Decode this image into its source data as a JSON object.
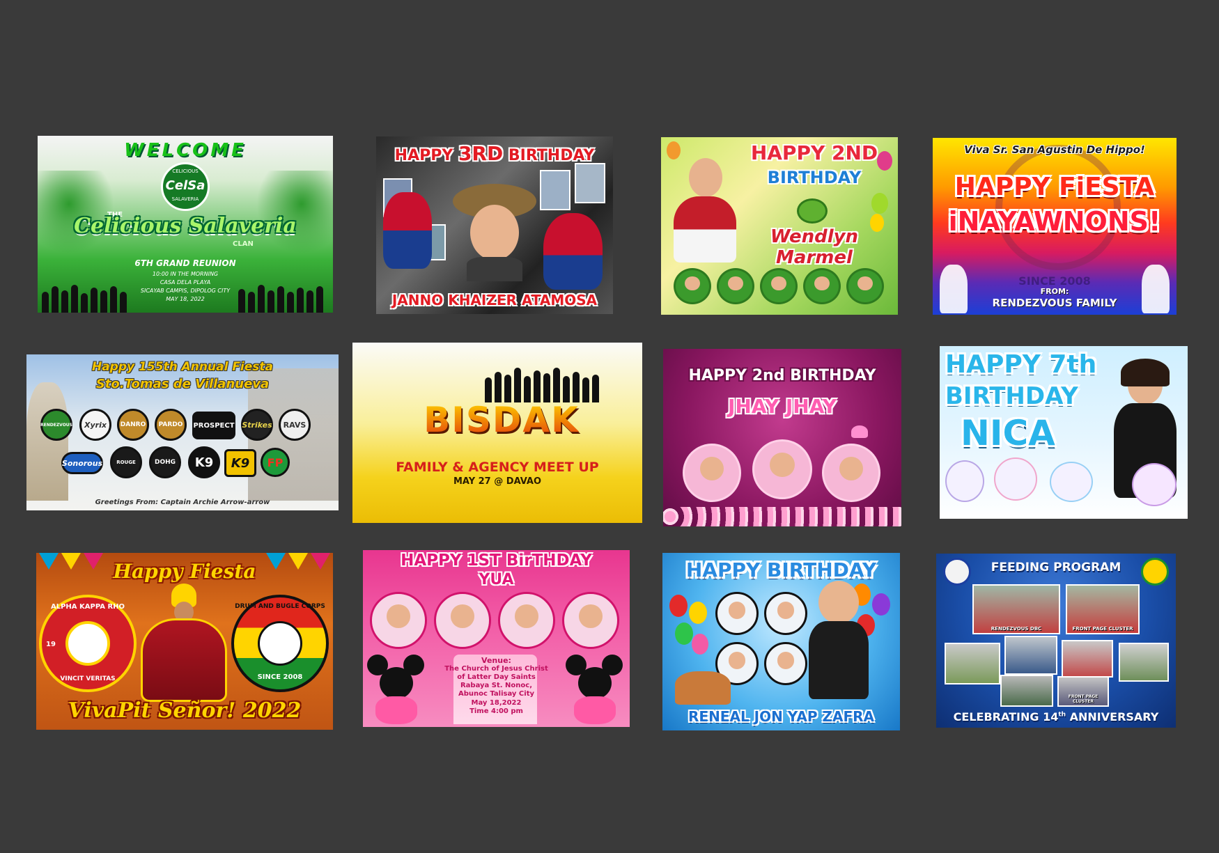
{
  "banners": [
    {
      "title": "WELCOME",
      "logo_top": "CELICIOUS",
      "logo_main": "CelSa",
      "logo_bottom": "SALAVERIA",
      "the": "THE",
      "clan_name": "Celicious Salaveria",
      "clan": "CLAN",
      "event": "6TH GRAND REUNION",
      "time": "10:00 IN THE MORNING",
      "venue": "CASA DELA PLAYA",
      "address": "SICAYAB CAMPIS, DIPOLOG CITY",
      "date": "MAY 18, 2022"
    },
    {
      "title_a": "HAPPY ",
      "title_num": "3RD",
      "title_b": " BIRTHDAY",
      "name": "JANNO KHAIZER ATAMOSA"
    },
    {
      "line1": "HAPPY 2ND",
      "line2": "BIRTHDAY",
      "name": "Wendlyn Marmel"
    },
    {
      "top": "Viva Sr. San Agustin De Hippo!",
      "line1": "HAPPY FiESTA",
      "line2": "iNAYAWNONS!",
      "from": "FROM:",
      "family": "RENDEZVOUS FAMILY",
      "since": "SINCE 2008"
    },
    {
      "line1": "Happy 155th Annual Fiesta",
      "line2": "Sto.Tomas de Villanueva",
      "logos": [
        "RENDEZVOUS",
        "Xyrix",
        "DANRO",
        "PARDO",
        "PROSPECT",
        "Strikes",
        "RAVS",
        "Sonorous",
        "ROUGE",
        "DOHG",
        "K9",
        "K9",
        "FP"
      ],
      "footer": "Greetings From: Captain Archie Arrow-arrow"
    },
    {
      "title": "BISDAK",
      "subtitle": "FAMILY & AGENCY MEET UP",
      "date": "MAY 27 @ DAVAO"
    },
    {
      "line1": "HAPPY 2nd BIRTHDAY",
      "name": "JHAY JHAY"
    },
    {
      "line1": "HAPPY 7th",
      "line2": "BIRTHDAY",
      "name": "NICA"
    },
    {
      "title": "Happy Fiesta",
      "left_logo_ring": "ALPHA KAPPA RHO",
      "left_logo_side": "VINCIT VERITAS",
      "left_logo_year": "19",
      "right_logo_ring": "DRUM AND BUGLE CORPS",
      "right_since": "SINCE 2008",
      "footer": "VivaPit Señor! 2022"
    },
    {
      "line1": "HAPPY 1ST BirTHDAY",
      "name": "YUA",
      "venue_label": "Venue:",
      "venue1": "The Church of Jesus Christ",
      "venue2": "of Latter Day Saints",
      "venue3": "Rabaya St. Nonoc,",
      "venue4": "Abunoc Talisay City",
      "date": "May 18,2022",
      "time": "Time 4:00 pm"
    },
    {
      "title": "HAPPY BIRTHDAY",
      "name": "RENEAL JON YAP ZAFRA"
    },
    {
      "title": "FEEDING PROGRAM",
      "footer_a": "CELEBRATING 14",
      "footer_sup": "th",
      "footer_b": " ANNIVERSARY",
      "photo_labels": [
        "RENDEZVOUS DBC",
        "FRONT PAGE CLUSTER",
        "FRONT PAGE CLUSTER"
      ]
    }
  ]
}
